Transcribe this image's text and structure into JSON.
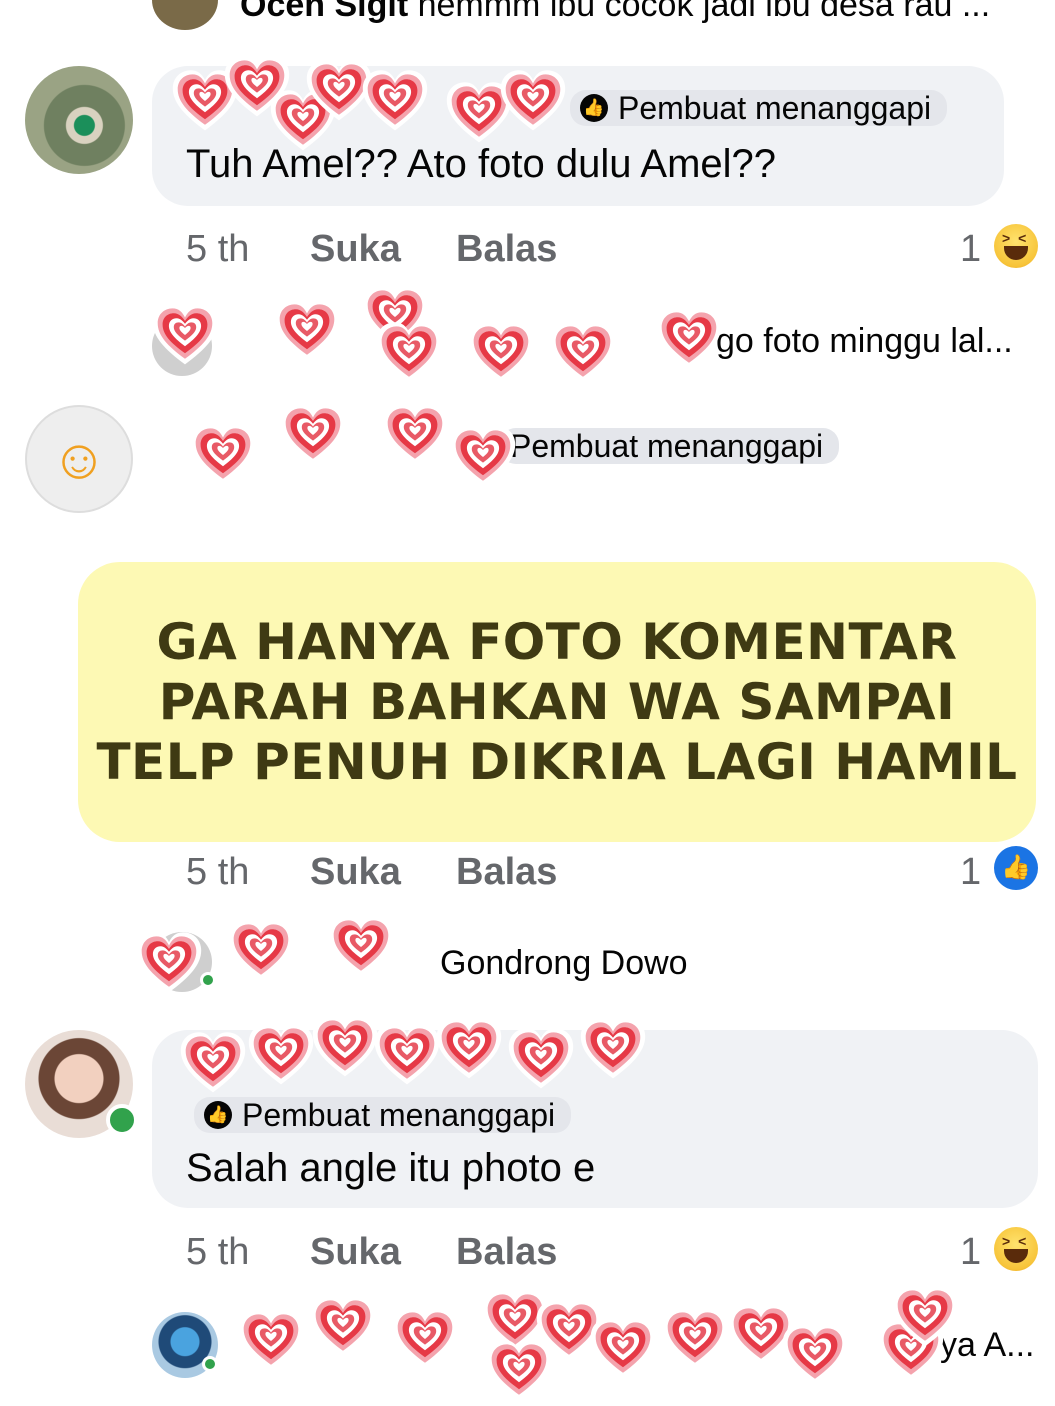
{
  "top_reply": {
    "name": "Ocen Sigit",
    "text": "hemmm ibu cocok jadi ibu desa rau ..."
  },
  "comments": [
    {
      "badge": "Pembuat menanggapi",
      "text": "Tuh Amel?? Ato foto dulu Amel??",
      "time": "5 th",
      "like": "Suka",
      "reply": "Balas",
      "reaction_count": "1",
      "reaction": "haha-icon"
    },
    {
      "badge": "Pembuat menanggapi",
      "text": "Salah angle itu photo e",
      "time": "5 th",
      "like": "Suka",
      "reply": "Balas",
      "reaction_count": "1",
      "reaction": "haha-icon"
    }
  ],
  "reply_preview_1": {
    "text": "go foto minggu lal..."
  },
  "reply_preview_2": {
    "badge": "Pembuat menanggapi",
    "avatar_emoji": "☺"
  },
  "highlight": {
    "lines": [
      "GA HANYA FOTO KOMENTAR",
      "PARAH BAHKAN WA SAMPAI",
      "TELP PENUH DIKRIA LAGI HAMIL"
    ]
  },
  "middle_meta": {
    "time": "5 th",
    "like": "Suka",
    "reply": "Balas",
    "reaction_count": "1",
    "reaction": "like-icon"
  },
  "reply_preview_3": {
    "text": "Gondrong Dowo"
  },
  "bottom_reply": {
    "text": "ya A..."
  },
  "colors": {
    "bubble": "#f0f2f5",
    "highlight_bg": "#fdf9b4",
    "highlight_text": "#3f3a13",
    "meta": "#65676b",
    "online": "#31a24c",
    "like_blue": "#1b74e4"
  }
}
